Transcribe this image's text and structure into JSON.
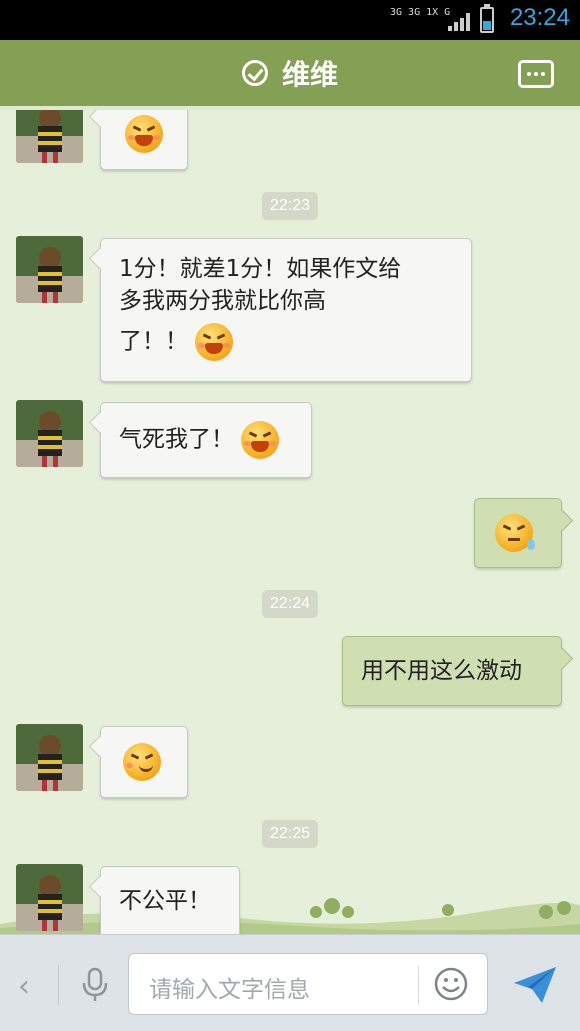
{
  "status_bar": {
    "network": "3G 3G 1X G",
    "time": "23:24",
    "battery_level": 0.4
  },
  "header": {
    "title": "维维",
    "verified_icon": "check-circle-icon",
    "menu_icon": "more-icon"
  },
  "messages": [
    {
      "side": "left",
      "text": "",
      "emoji": "grin-squint-icon"
    },
    {
      "type": "time",
      "text": "22:23"
    },
    {
      "side": "left",
      "lines": [
        "1分！就差1分！如果作文给",
        "多我两分我就比你高",
        "了！！"
      ],
      "emoji": "grin-squint-icon"
    },
    {
      "side": "left",
      "text": "气死我了！",
      "emoji": "grin-squint-icon"
    },
    {
      "side": "right",
      "text": "",
      "emoji": "sweat-icon"
    },
    {
      "type": "time",
      "text": "22:24"
    },
    {
      "side": "right",
      "text": "用不用这么激动"
    },
    {
      "side": "left",
      "text": "",
      "emoji": "smirk-icon"
    },
    {
      "type": "time",
      "text": "22:25"
    },
    {
      "side": "left",
      "text": "不公平！"
    }
  ],
  "input_bar": {
    "back_icon": "chevron-left-icon",
    "mic_icon": "microphone-icon",
    "placeholder": "请输入文字信息",
    "emoji_icon": "smiley-icon",
    "send_icon": "send-icon"
  },
  "colors": {
    "header": "#84a055",
    "chat_bg": "#e6efda",
    "sent_bubble": "#cfdfb2",
    "received_bubble": "#f6f6f4",
    "clock": "#33a7de"
  }
}
